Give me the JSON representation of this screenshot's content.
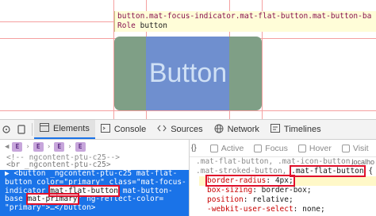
{
  "preview": {
    "tooltip_tag": "button.mat-focus-indicator.mat-flat-button.mat-button-ba",
    "tooltip_role_key": "Role",
    "tooltip_role_value": "button",
    "button_label": "Button"
  },
  "toolbar": {
    "tabs": [
      {
        "label": "Elements",
        "icon": "elements-icon"
      },
      {
        "label": "Console",
        "icon": "console-icon"
      },
      {
        "label": "Sources",
        "icon": "sources-icon"
      },
      {
        "label": "Network",
        "icon": "network-icon"
      },
      {
        "label": "Timelines",
        "icon": "timelines-icon"
      }
    ],
    "active_tab": "Elements"
  },
  "dom": {
    "breadcrumb_badges": [
      "E",
      "E",
      "E",
      "E"
    ],
    "line1": "<!--_ngcontent-ptu-c25-->",
    "line2": "<br _ngcontent-ptu-c25>",
    "line3": "<!--_ngcontent-ptu-c25-->",
    "selected": {
      "l1": "▶ <button _ngcontent-ptu-c25 mat-flat-",
      "l2a": "button color=\"primary\" class=\"mat-focus-",
      "l3a": "indicator ",
      "l3box": "mat-flat-button",
      "l3b": " mat-button-",
      "l4a": "base ",
      "l4box": "mat-primary",
      "l4b": "\" ng-reflect-color=",
      "l5": "\"primary\">…</button>"
    }
  },
  "styles": {
    "filters": [
      "Active",
      "Focus",
      "Hover",
      "Visit"
    ],
    "source": "localho",
    "selector_l1": ".mat-flat-button, .mat-icon-button,",
    "selector_l2a": ".mat-stroked-button, ",
    "selector_l2box": ".mat-flat-button",
    "selector_l2b": " {",
    "declarations": [
      {
        "prop": "border-radius",
        "value": "4px",
        "boxed": true
      },
      {
        "prop": "box-sizing",
        "value": "border-box",
        "boxed": false
      },
      {
        "prop": "position",
        "value": "relative",
        "boxed": false
      },
      {
        "prop": "-webkit-user-select",
        "value": "none",
        "boxed": false
      }
    ]
  },
  "colors": {
    "selection_blue": "#1a73e8",
    "highlight_margin": "#7f9f86",
    "highlight_content": "#6f8fcf",
    "annotation_red": "#e0102b"
  }
}
